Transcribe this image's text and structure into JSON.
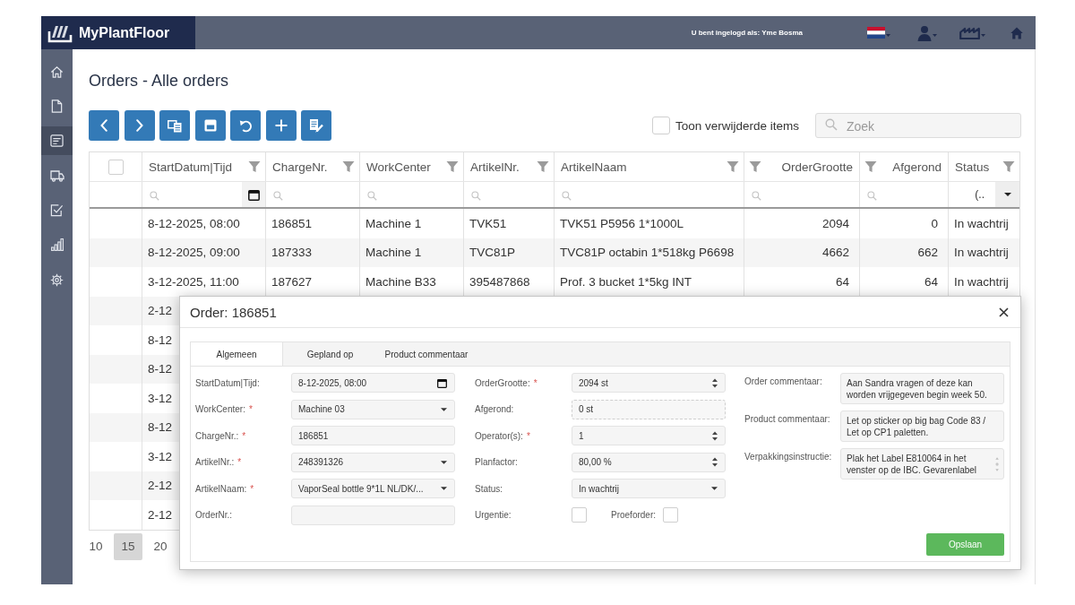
{
  "app": {
    "name": "MyPlantFloor",
    "login_text": "U bent ingelogd als: Yme Bosma"
  },
  "sidebar": {
    "items": [
      {
        "selected": false
      },
      {
        "selected": false
      },
      {
        "selected": true
      },
      {
        "selected": false
      },
      {
        "selected": false
      },
      {
        "selected": false
      },
      {
        "selected": false
      }
    ]
  },
  "page_title": "Orders - Alle orders",
  "show_deleted": {
    "label": "Toon verwijderde items",
    "checked": false
  },
  "search": {
    "placeholder": "Zoek"
  },
  "table": {
    "select_all": {
      "checked": false
    },
    "columns": [
      {
        "label": "StartDatum|Tijd",
        "kind": "date"
      },
      {
        "label": "ChargeNr.",
        "kind": "text"
      },
      {
        "label": "WorkCenter",
        "kind": "text"
      },
      {
        "label": "ArtikelNr.",
        "kind": "text"
      },
      {
        "label": "ArtikelNaam",
        "kind": "text"
      },
      {
        "label": "OrderGrootte",
        "kind": "number"
      },
      {
        "label": "Afgerond",
        "kind": "number"
      },
      {
        "label": "Status",
        "kind": "choice",
        "filter_value": "(.."
      }
    ],
    "rows": [
      {
        "cells": [
          "8-12-2025, 08:00",
          "186851",
          "Machine 1",
          "TVK51",
          "TVK51 P5956 1*1000L",
          "2094",
          "0",
          "In wachtrij"
        ]
      },
      {
        "cells": [
          "8-12-2025, 09:00",
          "187333",
          "Machine 1",
          "TVC81P",
          "TVC81P octabin 1*518kg P6698",
          "4662",
          "662",
          "In wachtrij"
        ]
      },
      {
        "cells": [
          "3-12-2025, 11:00",
          "187627",
          "Machine B33",
          "395487868",
          "Prof. 3 bucket 1*5kg INT",
          "64",
          "64",
          "In wachtrij"
        ]
      },
      {
        "cells": [
          "2-12"
        ]
      },
      {
        "cells": [
          "8-12"
        ]
      },
      {
        "cells": [
          "8-12"
        ]
      },
      {
        "cells": [
          "3-12"
        ]
      },
      {
        "cells": [
          "8-12"
        ]
      },
      {
        "cells": [
          "3-12"
        ]
      },
      {
        "cells": [
          "2-12"
        ]
      },
      {
        "cells": [
          "2-12"
        ]
      }
    ]
  },
  "page_sizes": [
    {
      "label": "10",
      "selected": false
    },
    {
      "label": "15",
      "selected": true
    },
    {
      "label": "20",
      "selected": false
    }
  ],
  "dialog": {
    "title": "Order: 186851",
    "tabs": [
      {
        "label": "Algemeen",
        "selected": true
      },
      {
        "label": "Gepland op",
        "selected": false
      },
      {
        "label": "Product commentaar",
        "selected": false
      }
    ],
    "columns": [
      {
        "fields": [
          {
            "label": "StartDatum|Tijd:",
            "kind": "date",
            "value": "8-12-2025, 08:00"
          },
          {
            "label": "WorkCenter:",
            "required_mark": "*",
            "kind": "select",
            "value": "Machine 03"
          },
          {
            "label": "ChargeNr.:",
            "required_mark": "*",
            "kind": "text",
            "value": "186851"
          },
          {
            "label": "ArtikelNr.:",
            "required_mark": "*",
            "kind": "select",
            "value": "248391326"
          },
          {
            "label": "ArtikelNaam:",
            "required_mark": "*",
            "kind": "select",
            "value": "VaporSeal bottle 9*1L NL/DK/..."
          },
          {
            "label": "OrderNr.:",
            "kind": "text"
          }
        ]
      },
      {
        "fields": [
          {
            "label": "OrderGrootte:",
            "required_mark": "*",
            "kind": "number",
            "value": "2094 st"
          },
          {
            "label": "Afgerond:",
            "kind": "readonly",
            "value": "0 st"
          },
          {
            "label": "Operator(s):",
            "required_mark": "*",
            "kind": "number",
            "value": "1"
          },
          {
            "label": "Planfactor:",
            "kind": "number",
            "value": "80,00 %"
          },
          {
            "label": "Status:",
            "kind": "select",
            "value": "In wachtrij"
          },
          {
            "kind": "checkboxes",
            "checks": [
              {
                "label": "Urgentie:",
                "checked": false
              },
              {
                "label": "Proeforder:",
                "checked": false
              }
            ]
          }
        ]
      },
      {
        "fields": [
          {
            "label": "Order commentaar:",
            "kind": "textarea",
            "value": "Aan Sandra vragen of deze kan worden vrijgegeven begin week 50."
          },
          {
            "label": "Product commentaar:",
            "kind": "textarea",
            "value": "Let op sticker op big bag Code 83 / Let op CP1 paletten."
          },
          {
            "label": "Verpakkingsinstructie:",
            "kind": "scrolltextarea",
            "value": "Plak het Label E810064 in het venster op de IBC. Gevarenlabel"
          }
        ]
      }
    ],
    "save_button": "Opslaan"
  }
}
